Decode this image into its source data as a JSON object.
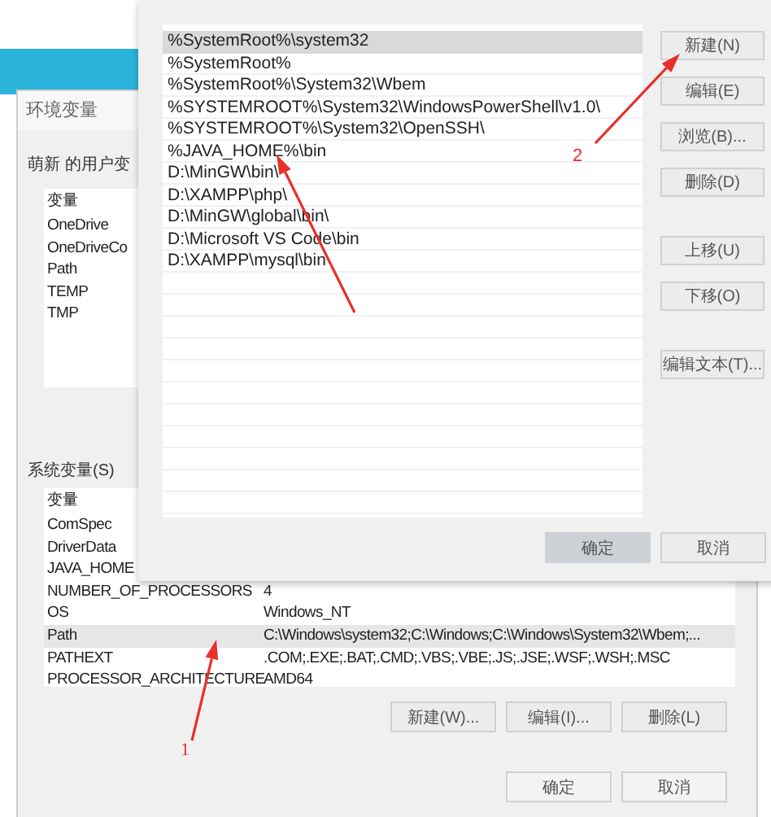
{
  "env_window": {
    "title": "环境变量",
    "user_section_label": "萌新 的用户变",
    "user_vars": {
      "columns": [
        "变量"
      ],
      "rows": [
        {
          "name": "OneDrive"
        },
        {
          "name": "OneDriveCo"
        },
        {
          "name": "Path"
        },
        {
          "name": "TEMP"
        },
        {
          "name": "TMP"
        }
      ]
    },
    "system_section_label": "系统变量(S)",
    "system_vars": {
      "columns": [
        "变量"
      ],
      "rows": [
        {
          "name": "ComSpec",
          "selected": false
        },
        {
          "name": "DriverData",
          "selected": false
        },
        {
          "name": "JAVA_HOME",
          "selected": false
        },
        {
          "name": "NUMBER_OF_PROCESSORS",
          "value": "4",
          "selected": false
        },
        {
          "name": "OS",
          "value": "Windows_NT",
          "selected": false
        },
        {
          "name": "Path",
          "value": "C:\\Windows\\system32;C:\\Windows;C:\\Windows\\System32\\Wbem;...",
          "selected": true
        },
        {
          "name": "PATHEXT",
          "value": ".COM;.EXE;.BAT;.CMD;.VBS;.VBE;.JS;.JSE;.WSF;.WSH;.MSC",
          "selected": false
        },
        {
          "name": "PROCESSOR_ARCHITECTURE",
          "value": "AMD64",
          "selected": false
        }
      ]
    },
    "system_buttons": [
      "新建(W)...",
      "编辑(I)...",
      "删除(L)"
    ],
    "buttons": [
      "确定",
      "取消"
    ]
  },
  "edit_dialog": {
    "paths": [
      {
        "text": "%SystemRoot%\\system32",
        "selected": true
      },
      {
        "text": "%SystemRoot%",
        "selected": false
      },
      {
        "text": "%SystemRoot%\\System32\\Wbem",
        "selected": false
      },
      {
        "text": "%SYSTEMROOT%\\System32\\WindowsPowerShell\\v1.0\\",
        "selected": false
      },
      {
        "text": "%SYSTEMROOT%\\System32\\OpenSSH\\",
        "selected": false
      },
      {
        "text": "%JAVA_HOME%\\bin",
        "selected": false
      },
      {
        "text": "D:\\MinGW\\bin\\",
        "selected": false
      },
      {
        "text": "D:\\XAMPP\\php\\",
        "selected": false
      },
      {
        "text": "D:\\MinGW\\global\\bin\\",
        "selected": false
      },
      {
        "text": "D:\\Microsoft VS Code\\bin",
        "selected": false
      },
      {
        "text": "D:\\XAMPP\\mysql\\bin",
        "selected": false
      }
    ],
    "side_button_groups": [
      [
        "新建(N)",
        "编辑(E)",
        "浏览(B)...",
        "删除(D)"
      ],
      [
        "上移(U)",
        "下移(O)"
      ],
      [
        "编辑文本(T)..."
      ]
    ],
    "buttons": [
      {
        "label": "确定",
        "default": true
      },
      {
        "label": "取消",
        "default": false
      }
    ]
  },
  "annotations": [
    {
      "kind": "arrow"
    },
    {
      "kind": "numbered-arrow",
      "number": "1"
    },
    {
      "kind": "numbered-arrow",
      "number": "2"
    }
  ]
}
